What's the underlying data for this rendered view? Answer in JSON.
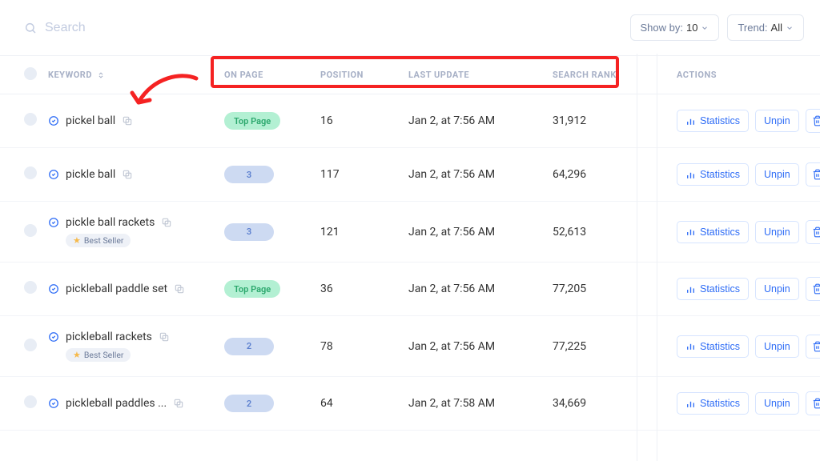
{
  "search": {
    "placeholder": "Search"
  },
  "controls": {
    "showby_label": "Show by:",
    "showby_value": "10",
    "trend_label": "Trend:",
    "trend_value": "All"
  },
  "headers": {
    "keyword": "Keyword",
    "onpage": "On Page",
    "position": "Position",
    "update": "Last Update",
    "rank": "Search Rank",
    "actions": "Actions"
  },
  "pill_labels": {
    "top": "Top Page"
  },
  "tag_labels": {
    "bestseller": "Best Seller"
  },
  "action_labels": {
    "statistics": "Statistics",
    "unpin": "Unpin"
  },
  "rows": [
    {
      "keyword": "pickel ball",
      "badge_type": "top",
      "badge_text": "Top Page",
      "position": "16",
      "update": "Jan 2, at 7:56 AM",
      "rank": "31,912",
      "bestseller": false
    },
    {
      "keyword": "pickle ball",
      "badge_type": "num",
      "badge_text": "3",
      "position": "117",
      "update": "Jan 2, at 7:56 AM",
      "rank": "64,296",
      "bestseller": false
    },
    {
      "keyword": "pickle ball rackets",
      "badge_type": "num",
      "badge_text": "3",
      "position": "121",
      "update": "Jan 2, at 7:56 AM",
      "rank": "52,613",
      "bestseller": true
    },
    {
      "keyword": "pickleball paddle set",
      "badge_type": "top",
      "badge_text": "Top Page",
      "position": "36",
      "update": "Jan 2, at 7:56 AM",
      "rank": "77,205",
      "bestseller": false
    },
    {
      "keyword": "pickleball rackets",
      "badge_type": "num",
      "badge_text": "2",
      "position": "78",
      "update": "Jan 2, at 7:56 AM",
      "rank": "77,225",
      "bestseller": true
    },
    {
      "keyword": "pickleball paddles ...",
      "badge_type": "num",
      "badge_text": "2",
      "position": "64",
      "update": "Jan 2, at 7:58 AM",
      "rank": "34,669",
      "bestseller": false
    }
  ]
}
